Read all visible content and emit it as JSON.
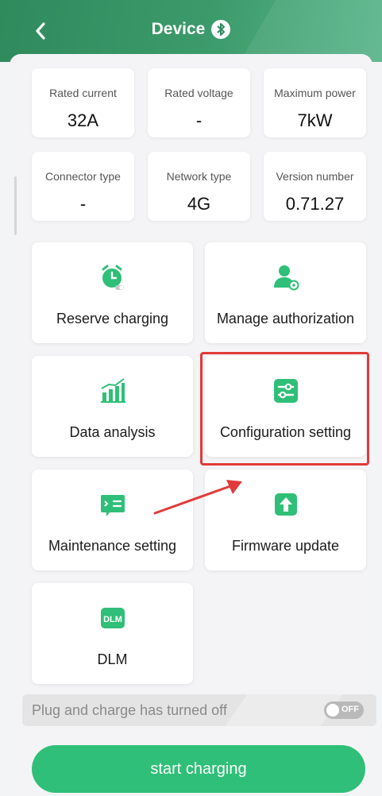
{
  "header": {
    "title": "Device",
    "back_icon": "chevron-left-icon",
    "bluetooth_icon": "bluetooth-icon",
    "accent": "#3c9b6b"
  },
  "info_cards": [
    {
      "label": "Rated current",
      "value": "32A"
    },
    {
      "label": "Rated voltage",
      "value": "-"
    },
    {
      "label": "Maximum power",
      "value": "7kW"
    },
    {
      "label": "Connector type",
      "value": "-"
    },
    {
      "label": "Network type",
      "value": "4G"
    },
    {
      "label": "Version number",
      "value": "0.71.27"
    }
  ],
  "tiles": [
    {
      "label": "Reserve charging",
      "icon": "alarm-clock-icon"
    },
    {
      "label": "Manage authorization",
      "icon": "user-settings-icon"
    },
    {
      "label": "Data analysis",
      "icon": "bar-chart-icon"
    },
    {
      "label": "Configuration setting",
      "icon": "sliders-icon"
    },
    {
      "label": "Maintenance setting",
      "icon": "maintenance-card-icon"
    },
    {
      "label": "Firmware update",
      "icon": "upload-arrow-icon"
    },
    {
      "label": "DLM",
      "icon": "dlm-icon",
      "icon_text": "DLM"
    }
  ],
  "plug_and_charge": {
    "text": "Plug and charge has turned off",
    "toggle_text": "OFF"
  },
  "start_button": {
    "label": "start charging",
    "color": "#2fbf78"
  },
  "annotation": {
    "highlight_color": "#e23a3a"
  }
}
